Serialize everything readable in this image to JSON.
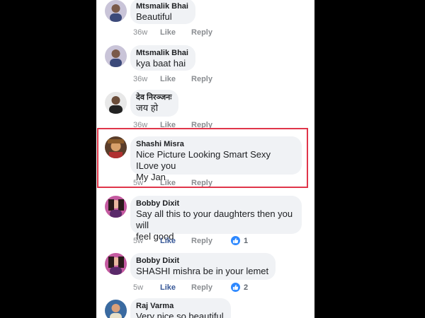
{
  "comments": [
    {
      "author": "Mtsmalik Bhai",
      "text": "Beautiful",
      "time": "36w",
      "like_label": "Like",
      "reply_label": "Reply"
    },
    {
      "author": "Mtsmalik Bhai",
      "text": "kya baat hai",
      "time": "36w",
      "like_label": "Like",
      "reply_label": "Reply"
    },
    {
      "author": "देव निरञ्जनः",
      "text": "जय हो",
      "time": "36w",
      "like_label": "Like",
      "reply_label": "Reply"
    },
    {
      "author": "Shashi Misra",
      "text_line1": "Nice Picture Looking Smart Sexy ILove you",
      "text_line2": "My Jan",
      "time": "5w",
      "like_label": "Like",
      "reply_label": "Reply"
    },
    {
      "author": "Bobby Dixit",
      "text_line1": "Say all this to your daughters then you will",
      "text_line2": "feel good",
      "time": "5w",
      "like_label": "Like",
      "reply_label": "Reply",
      "reaction_count": "1"
    },
    {
      "author": "Bobby Dixit",
      "text": "SHASHI mishra be in your lemet",
      "time": "5w",
      "like_label": "Like",
      "reply_label": "Reply",
      "reaction_count": "2"
    },
    {
      "author": "Raj Varma",
      "text": "Very nice so beautiful"
    }
  ],
  "colors": {
    "highlight": "#e0354a",
    "like_active": "#385898",
    "reaction_blue": "#2d88ff",
    "bubble": "#f0f2f5"
  },
  "icons": {
    "reaction": "thumbs-up-icon"
  }
}
